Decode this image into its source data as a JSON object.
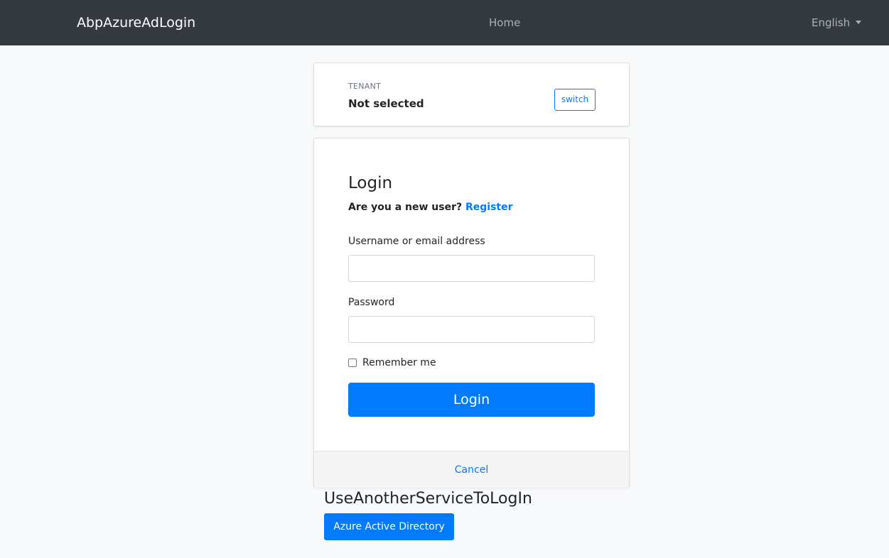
{
  "navbar": {
    "brand": "AbpAzureAdLogin",
    "home_label": "Home",
    "language_label": "English"
  },
  "tenant": {
    "label": "TENANT",
    "value": "Not selected",
    "switch_label": "switch"
  },
  "login": {
    "title": "Login",
    "new_user_prompt": "Are you a new user?",
    "register_label": "Register",
    "username_label": "Username or email address",
    "username_value": "",
    "password_label": "Password",
    "password_value": "",
    "remember_label": "Remember me",
    "remember_checked": false,
    "submit_label": "Login",
    "cancel_label": "Cancel"
  },
  "external": {
    "title": "UseAnotherServiceToLogIn",
    "azure_label": "Azure Active Directory"
  },
  "colors": {
    "navbar_bg": "#343a40",
    "primary": "#007bff",
    "page_bg": "#f8f9fa"
  }
}
